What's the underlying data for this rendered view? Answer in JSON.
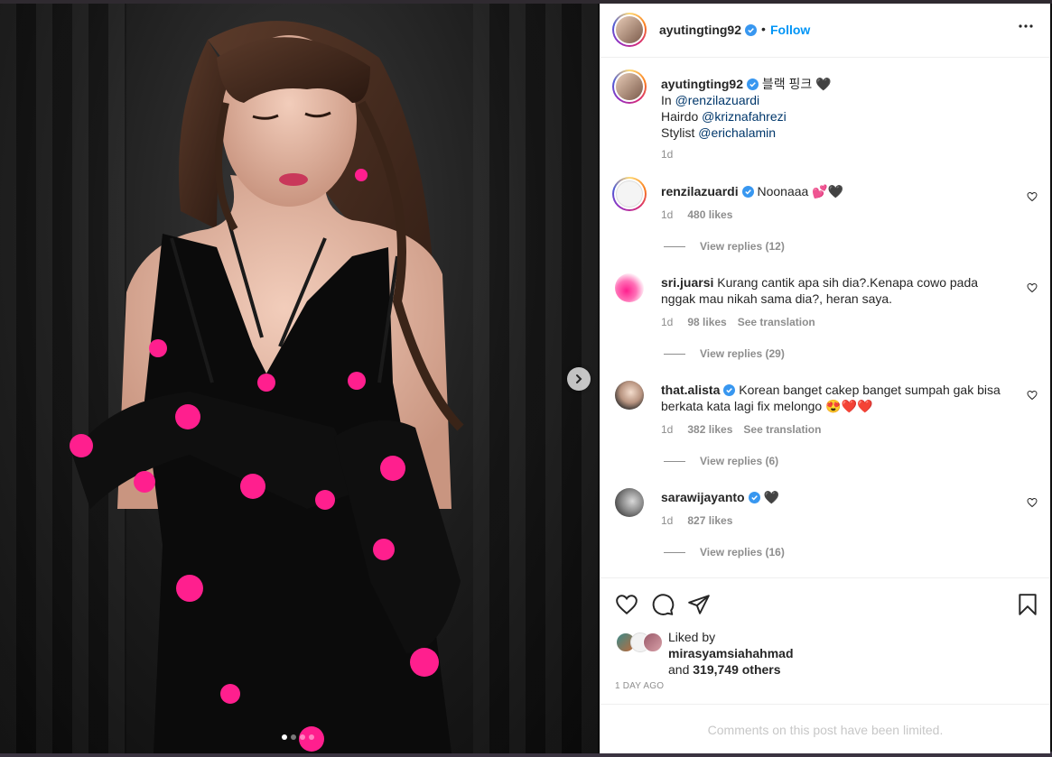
{
  "header": {
    "username": "ayutingting92",
    "follow_label": "Follow",
    "separator": "•"
  },
  "caption": {
    "username": "ayutingting92",
    "text": "블랙 핑크 🖤",
    "in_label": "In",
    "in_mention": "@renzilazuardi",
    "hairdo_label": "Hairdo",
    "hairdo_mention": "@kriznafahrezi",
    "stylist_label": "Stylist",
    "stylist_mention": "@erichalamin",
    "time": "1d"
  },
  "comments": [
    {
      "username": "renzilazuardi",
      "verified": true,
      "text": "Noonaaa 💕🖤",
      "time": "1d",
      "likes": "480 likes",
      "see_translation": "",
      "replies": "View replies (12)"
    },
    {
      "username": "sri.juarsi",
      "verified": false,
      "text": "Kurang cantik apa sih dia?.Kenapa cowo pada nggak mau nikah sama dia?, heran saya.",
      "time": "1d",
      "likes": "98 likes",
      "see_translation": "See translation",
      "replies": "View replies (29)"
    },
    {
      "username": "that.alista",
      "verified": true,
      "text": "Korean banget cakep banget sumpah gak bisa berkata kata lagi fix melongo 😍❤️❤️",
      "time": "1d",
      "likes": "382 likes",
      "see_translation": "See translation",
      "replies": "View replies (6)"
    },
    {
      "username": "sarawijayanto",
      "verified": true,
      "text": "🖤",
      "time": "1d",
      "likes": "827 likes",
      "see_translation": "",
      "replies": "View replies (16)"
    }
  ],
  "likes_section": {
    "liked_by_label": "Liked by",
    "liked_by_user": "mirasyamsiahahmad",
    "and_label": "and",
    "others": "319,749 others",
    "timestamp": "1 DAY AGO"
  },
  "comments_limited": "Comments on this post have been limited.",
  "media": {
    "carousel_total": 4,
    "carousel_active": 1
  },
  "colors": {
    "link": "#00376b",
    "follow": "#0095f6",
    "verified": "#3897f0",
    "muted": "#8e8e8e",
    "pom": "#ff1f8e"
  },
  "icons": [
    "verified-icon",
    "more-icon",
    "heart-icon",
    "comment-icon",
    "share-icon",
    "bookmark-icon",
    "chevron-right-icon"
  ]
}
